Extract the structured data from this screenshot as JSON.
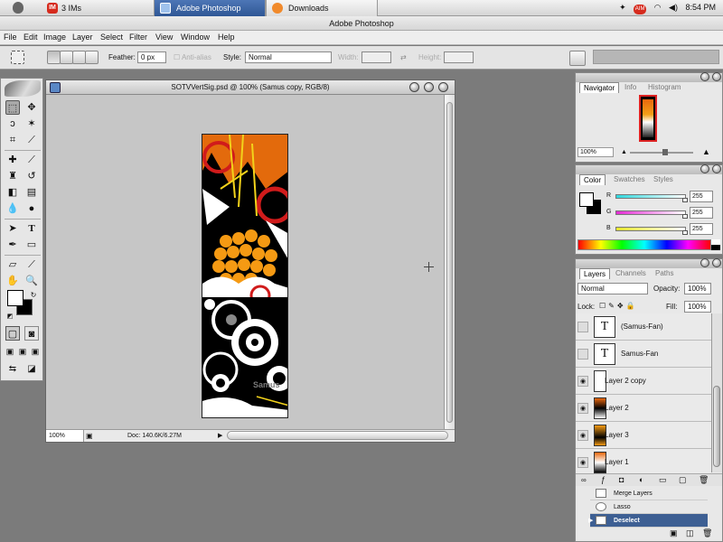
{
  "os": {
    "ims": "3 IMs",
    "ims_badge": "IM",
    "tabs": [
      {
        "label": "Adobe Photoshop"
      },
      {
        "label": "Downloads"
      }
    ],
    "aim_badge": "AIM",
    "clock": "8:54 PM"
  },
  "app": {
    "title": "Adobe Photoshop",
    "menu": [
      "File",
      "Edit",
      "Image",
      "Layer",
      "Select",
      "Filter",
      "View",
      "Window",
      "Help"
    ]
  },
  "options": {
    "feather_label": "Feather:",
    "feather_value": "0 px",
    "antialias_label": "Anti-alias",
    "style_label": "Style:",
    "style_value": "Normal",
    "width_label": "Width:",
    "height_label": "Height:"
  },
  "document": {
    "title": "SOTVVertSig.psd @ 100% (Samus copy, RGB/8)",
    "zoom": "100%",
    "doc_size": "Doc: 140.6K/6.27M",
    "art_text": "Samus"
  },
  "navigator": {
    "tabs": [
      "Navigator",
      "Info",
      "Histogram"
    ],
    "zoom": "100%"
  },
  "color": {
    "tabs": [
      "Color",
      "Swatches",
      "Styles"
    ],
    "r": {
      "label": "R",
      "value": "255"
    },
    "g": {
      "label": "G",
      "value": "255"
    },
    "b": {
      "label": "B",
      "value": "255"
    },
    "colors": {
      "r_bar": "#2fd8de",
      "g_bar": "#e42bd4",
      "b_bar": "#e6e62a"
    }
  },
  "layers": {
    "tabs": [
      "Layers",
      "Channels",
      "Paths"
    ],
    "blend_mode": "Normal",
    "opacity_label": "Opacity:",
    "opacity_value": "100%",
    "lock_label": "Lock:",
    "fill_label": "Fill:",
    "fill_value": "100%",
    "items": [
      {
        "name": "(Samus-Fan)",
        "type": "text"
      },
      {
        "name": "Samus-Fan",
        "type": "text"
      },
      {
        "name": "Layer 2 copy",
        "type": "image"
      },
      {
        "name": "Layer 2",
        "type": "image"
      },
      {
        "name": "Layer 3",
        "type": "image"
      },
      {
        "name": "Layer 1",
        "type": "image"
      }
    ]
  },
  "history": {
    "items": [
      {
        "name": "Merge Layers"
      },
      {
        "name": "Lasso"
      },
      {
        "name": "Deselect"
      }
    ]
  }
}
